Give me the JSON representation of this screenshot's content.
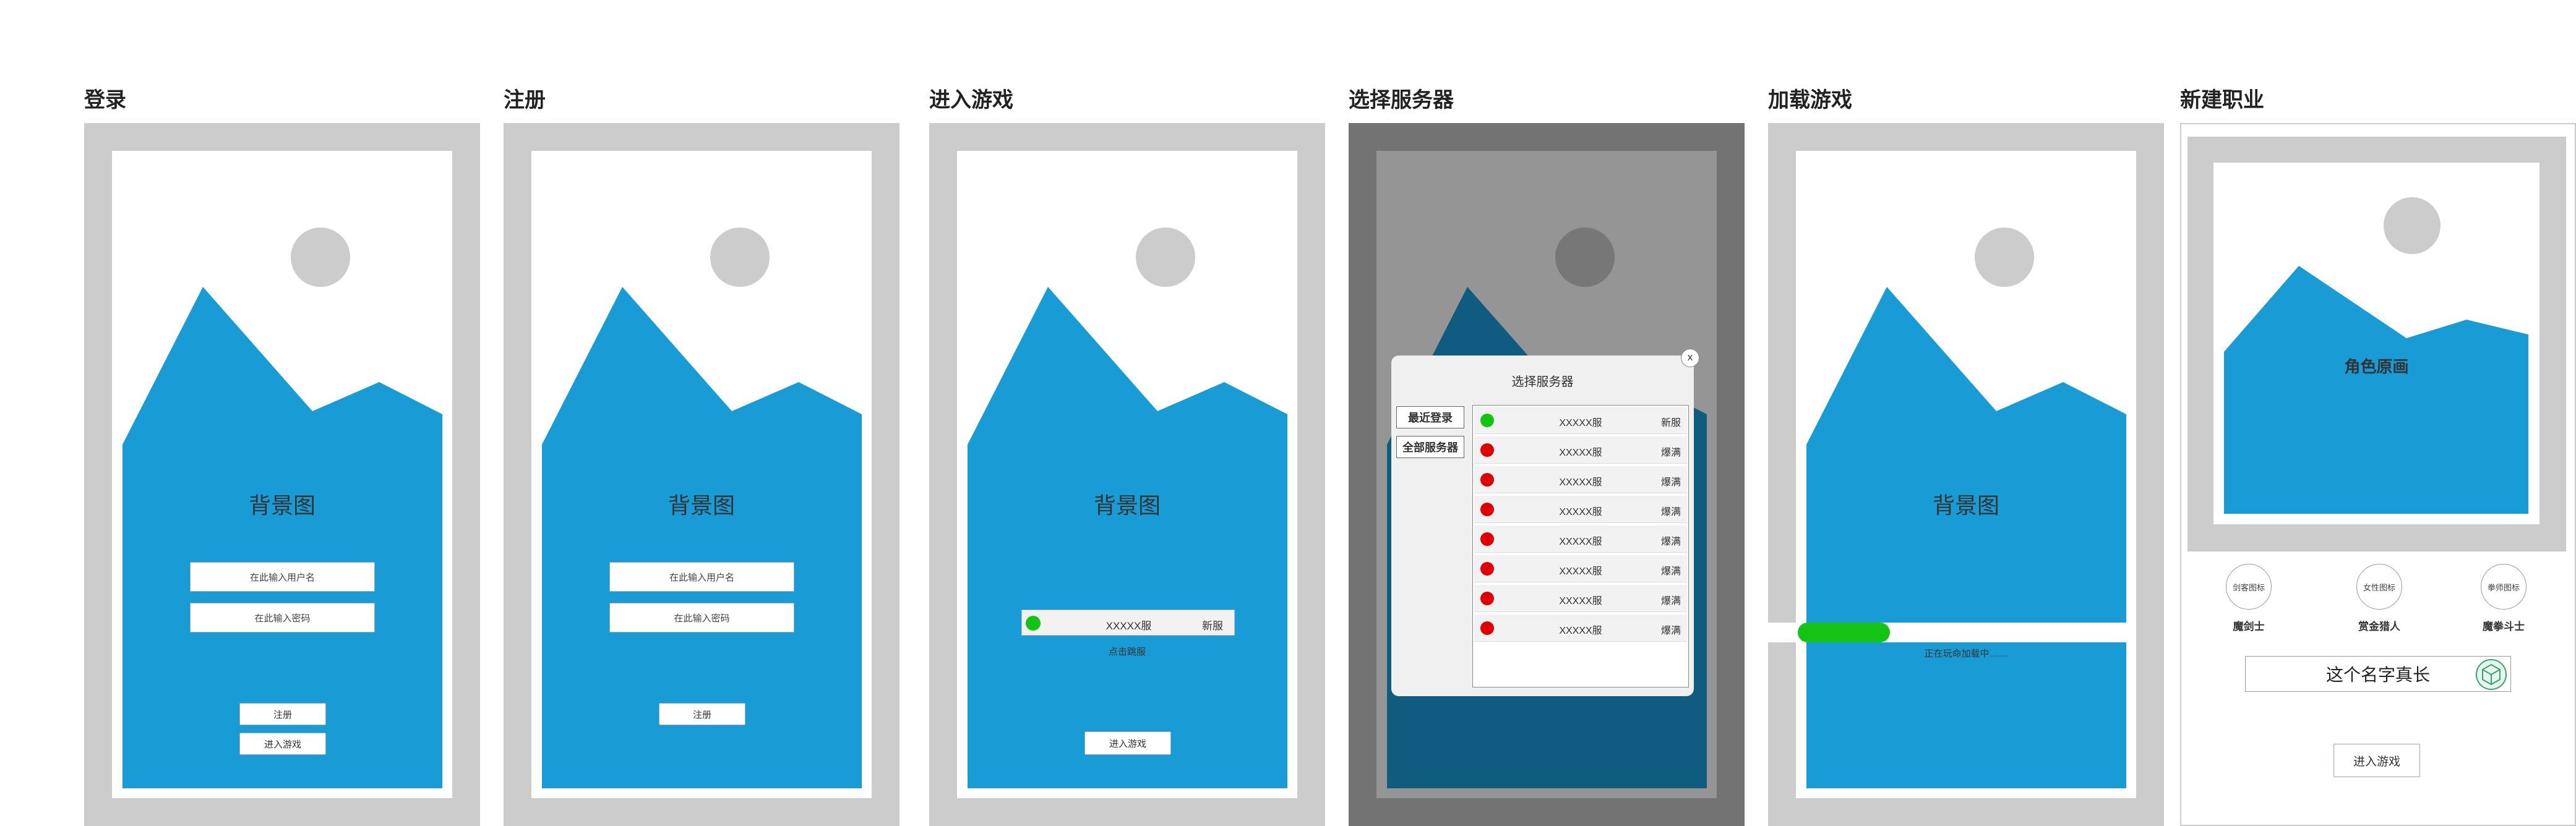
{
  "colors": {
    "frame": "#cccccc",
    "dark_frame": "#737373",
    "dim_canvas": "#959595",
    "mountain": "#199bd5",
    "mountain_dim": "#105c80",
    "sun": "#cccccc",
    "sun_dim": "#777777",
    "online": "#14c414",
    "full": "#e00000"
  },
  "panels": {
    "login": {
      "title": "登录",
      "bg_label": "背景图",
      "username_placeholder": "在此输入用户名",
      "password_placeholder": "在此输入密码",
      "register_label": "注册",
      "enter_game_label": "进入游戏"
    },
    "register": {
      "title": "注册",
      "bg_label": "背景图",
      "username_placeholder": "在此输入用户名",
      "password_placeholder": "在此输入密码",
      "register_label": "注册"
    },
    "enter_game": {
      "title": "进入游戏",
      "bg_label": "背景图",
      "server_name": "XXXXX服",
      "server_status": "新服",
      "hint": "点击跳服",
      "enter_game_label": "进入游戏"
    },
    "select_server": {
      "title": "选择服务器",
      "modal_title": "选择服务器",
      "close_label": "x",
      "tab_recent": "最近登录",
      "tab_all": "全部服务器",
      "servers": [
        {
          "name": "XXXXX服",
          "status": "新服",
          "dot": "green"
        },
        {
          "name": "XXXXX服",
          "status": "爆满",
          "dot": "red"
        },
        {
          "name": "XXXXX服",
          "status": "爆满",
          "dot": "red"
        },
        {
          "name": "XXXXX服",
          "status": "爆满",
          "dot": "red"
        },
        {
          "name": "XXXXX服",
          "status": "爆满",
          "dot": "red"
        },
        {
          "name": "XXXXX服",
          "status": "爆满",
          "dot": "red"
        },
        {
          "name": "XXXXX服",
          "status": "爆满",
          "dot": "red"
        },
        {
          "name": "XXXXX服",
          "status": "爆满",
          "dot": "red"
        }
      ]
    },
    "loading": {
      "title": "加载游戏",
      "bg_label": "背景图",
      "progress": 0.15,
      "loading_text": "正在玩命加载中……"
    },
    "new_class": {
      "title": "新建职业",
      "art_label": "角色原画",
      "classes": [
        {
          "icon_label": "剑客图标",
          "name": "魔剑士"
        },
        {
          "icon_label": "女性图标",
          "name": "赏金猎人"
        },
        {
          "icon_label": "拳师图标",
          "name": "魔拳斗士"
        }
      ],
      "name_value": "这个名字真长",
      "enter_game_label": "进入游戏",
      "random_icon": "dice-icon"
    }
  }
}
